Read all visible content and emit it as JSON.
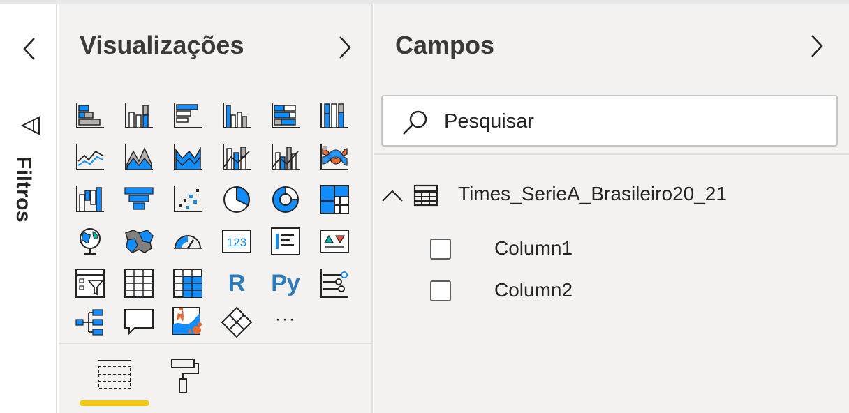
{
  "filters": {
    "label": "Filtros"
  },
  "visualizations": {
    "title": "Visualizações",
    "icons": [
      "stacked-bar-chart-icon",
      "stacked-column-chart-icon",
      "clustered-bar-chart-icon",
      "clustered-column-chart-icon",
      "100-stacked-bar-chart-icon",
      "100-stacked-column-chart-icon",
      "line-chart-icon",
      "area-chart-icon",
      "stacked-area-chart-icon",
      "line-and-stacked-column-chart-icon",
      "line-and-clustered-column-chart-icon",
      "ribbon-chart-icon",
      "waterfall-chart-icon",
      "funnel-chart-icon",
      "scatter-chart-icon",
      "pie-chart-icon",
      "donut-chart-icon",
      "treemap-icon",
      "map-icon",
      "filled-map-icon",
      "gauge-icon",
      "card-icon",
      "multi-row-card-icon",
      "kpi-icon",
      "slicer-icon",
      "table-icon",
      "matrix-icon",
      "r-script-visual-icon",
      "python-visual-icon",
      "key-influencers-icon",
      "decomposition-tree-icon",
      "qa-icon",
      "arcgis-map-icon",
      "power-apps-icon",
      "more-visuals-icon"
    ],
    "r_label": "R",
    "py_label": "Py",
    "card_label": "123",
    "more_label": "···",
    "tabs": [
      "fields-tab-icon",
      "format-tab-icon"
    ],
    "colors": {
      "accent": "#118dff",
      "tab_underline": "#f2c811"
    }
  },
  "fields": {
    "title": "Campos",
    "search_placeholder": "Pesquisar",
    "table": {
      "name": "Times_SerieA_Brasileiro20_21",
      "columns": [
        "Column1",
        "Column2"
      ]
    }
  }
}
